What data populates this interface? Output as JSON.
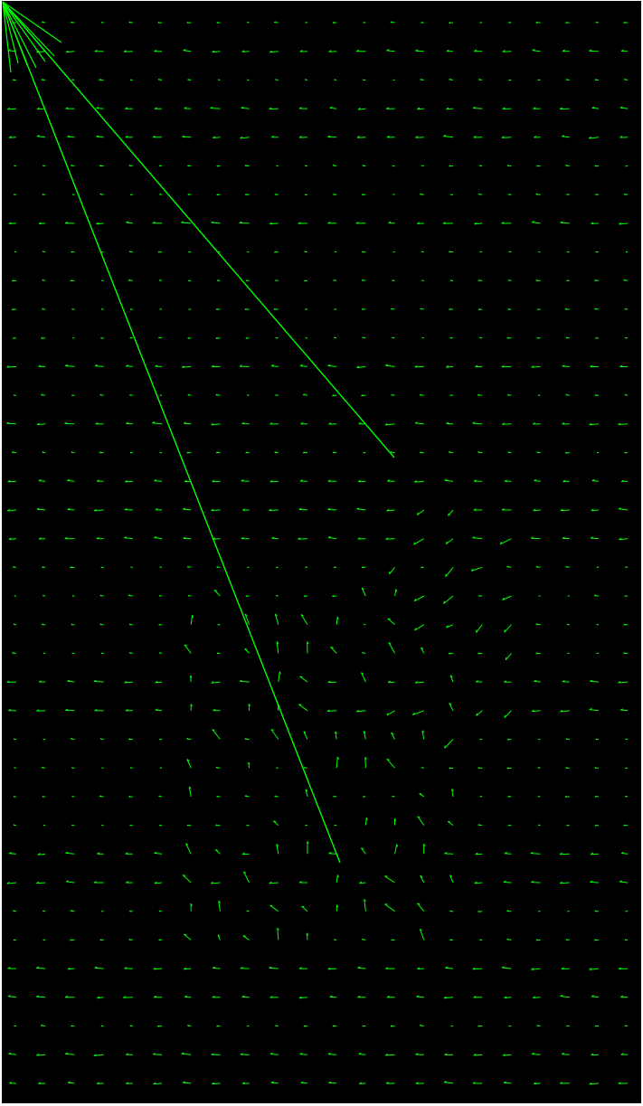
{
  "image": {
    "kind": "optical-flow-visualization",
    "background_color": "#000000",
    "frame_color": "#ffffff",
    "vector_color": "#00ff00",
    "grid": {
      "columns": 22,
      "rows": 38
    },
    "dominant_flow_direction": "leftward",
    "long_vectors": [
      {
        "name": "long-vector-1",
        "direction": "up-left"
      },
      {
        "name": "long-vector-2",
        "direction": "up-left"
      }
    ],
    "text_labels": []
  }
}
